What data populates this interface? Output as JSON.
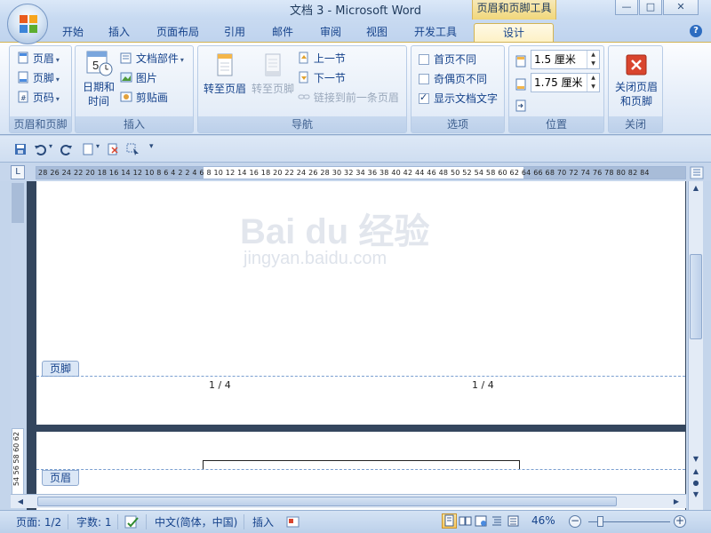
{
  "window": {
    "title": "文档 3 - Microsoft Word",
    "context_tool_title": "页眉和页脚工具",
    "min_glyph": "—",
    "max_glyph": "□",
    "close_glyph": "✕"
  },
  "tabs": [
    {
      "label": "开始"
    },
    {
      "label": "插入"
    },
    {
      "label": "页面布局"
    },
    {
      "label": "引用"
    },
    {
      "label": "邮件"
    },
    {
      "label": "审阅"
    },
    {
      "label": "视图"
    },
    {
      "label": "开发工具"
    },
    {
      "label": "设计"
    }
  ],
  "help_glyph": "?",
  "ribbon": {
    "groups": {
      "header_footer": {
        "label": "页眉和页脚",
        "header": "页眉",
        "footer": "页脚",
        "page_number": "页码"
      },
      "insert": {
        "label": "插入",
        "date_time_line1": "日期和",
        "date_time_line2": "时间",
        "quick_parts": "文档部件",
        "picture": "图片",
        "clip_art": "剪贴画"
      },
      "navigation": {
        "label": "导航",
        "goto_header": "转至页眉",
        "goto_footer": "转至页脚",
        "previous_section": "上一节",
        "next_section": "下一节",
        "link_to_previous": "链接到前一条页眉"
      },
      "options": {
        "label": "选项",
        "different_first_page": "首页不同",
        "different_odd_even": "奇偶页不同",
        "show_document_text": "显示文档文字",
        "different_first_page_checked": false,
        "different_odd_even_checked": false,
        "show_document_text_checked": true
      },
      "position": {
        "label": "位置",
        "header_from_top": "1.5 厘米",
        "footer_from_bottom": "1.75 厘米"
      },
      "close": {
        "label": "关闭",
        "close_line1": "关闭页眉",
        "close_line2": "和页脚"
      }
    }
  },
  "ruler": {
    "horizontal_ticks": "28 26 24 22 20 18 16 14 12 10  8   6   4   2      2   4   6   8  10 12 14 16 18 20 22 24 26 28 30 32 34 36 38 40 42 44 46 48 50 52 54      58 60 62 64 66 68 70 72 74 76 78 80 82 84",
    "vertical_ticks": "54 56 58 60 62",
    "corner_glyph": "L"
  },
  "document": {
    "footer_tag": "页脚",
    "header_tag": "页眉",
    "page_number_left": "1 / 4",
    "page_number_right": "1 / 4"
  },
  "watermark": {
    "brand": "Bai du 经验",
    "url": "jingyan.baidu.com"
  },
  "status": {
    "page": "页面: 1/2",
    "words": "字数: 1",
    "language": "中文(简体，中国)",
    "mode": "插入",
    "zoom": "46%",
    "zoom_minus": "−",
    "zoom_plus": "+"
  },
  "colors": {
    "accent_tab": "#fdf1c4",
    "ribbon_text": "#15428b",
    "close_red": "#d9452e"
  }
}
